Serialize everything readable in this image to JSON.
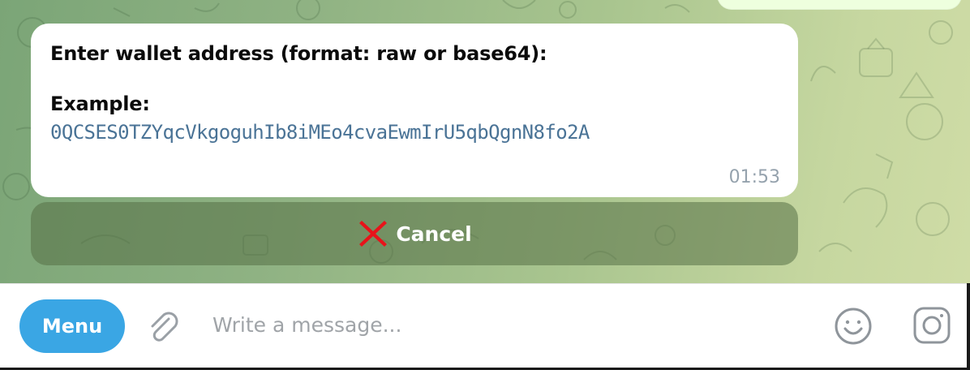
{
  "message": {
    "line1": "Enter wallet address (format: raw or base64):",
    "line2": "Example:",
    "address": "0QCSES0TZYqcVkgoguhIb8iMEo4cvaEwmIrU5qbQgnN8fo2A",
    "time": "01:53"
  },
  "keyboard": {
    "cancel_label": "Cancel",
    "cancel_icon": "cross-mark-icon"
  },
  "composer": {
    "menu_label": "Menu",
    "placeholder": "Write a message...",
    "attach_icon": "paperclip-icon",
    "emoji_icon": "smiley-icon",
    "camera_icon": "instagram-camera-icon"
  },
  "colors": {
    "accent": "#3aa6e4",
    "cancel_icon": "#e8131a",
    "link_text": "#4a7396"
  }
}
